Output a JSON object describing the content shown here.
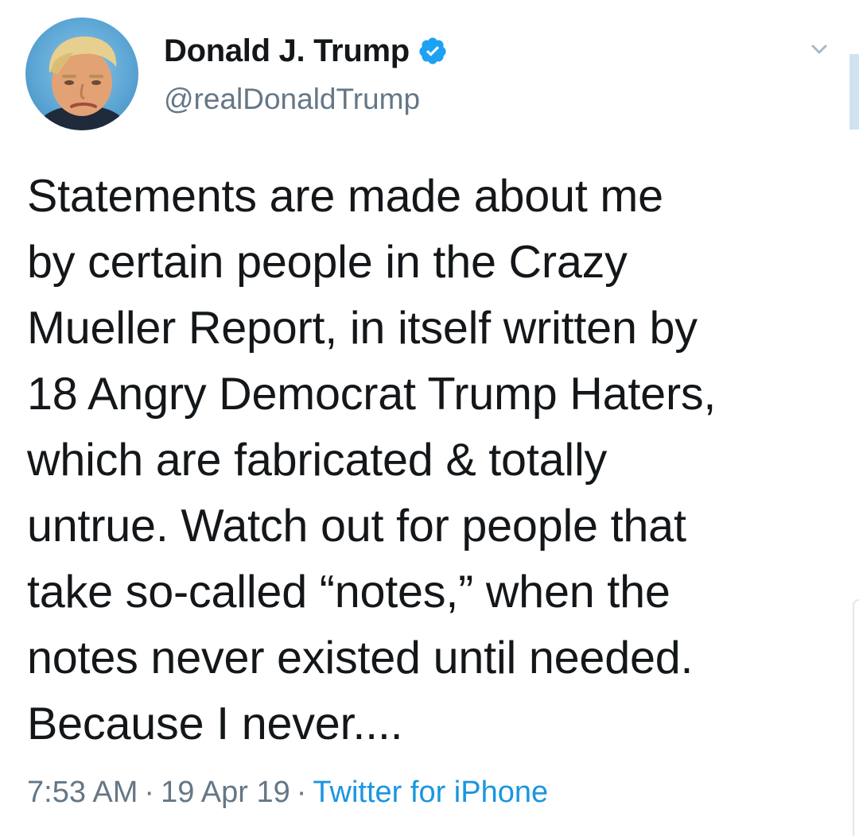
{
  "tweet": {
    "author": {
      "display_name": "Donald J. Trump",
      "handle": "@realDonaldTrump",
      "verified": true,
      "avatar_icon": "profile-photo"
    },
    "text_lines": [
      "Statements are made about me",
      "by certain people in the Crazy",
      "Mueller Report, in itself written by",
      "18 Angry Democrat Trump Haters,",
      "which are fabricated & totally",
      "untrue. Watch out for people that",
      "take so-called “notes,” when the",
      "notes never existed until needed.",
      "Because I never...."
    ],
    "meta": {
      "time": "7:53 AM",
      "date": "19 Apr 19",
      "separator": "·",
      "source": "Twitter for iPhone"
    },
    "menu_icon": "chevron-down-icon"
  },
  "colors": {
    "text": "#14171a",
    "secondary": "#657786",
    "link": "#1b95e0",
    "verified_badge": "#1da1f2"
  }
}
